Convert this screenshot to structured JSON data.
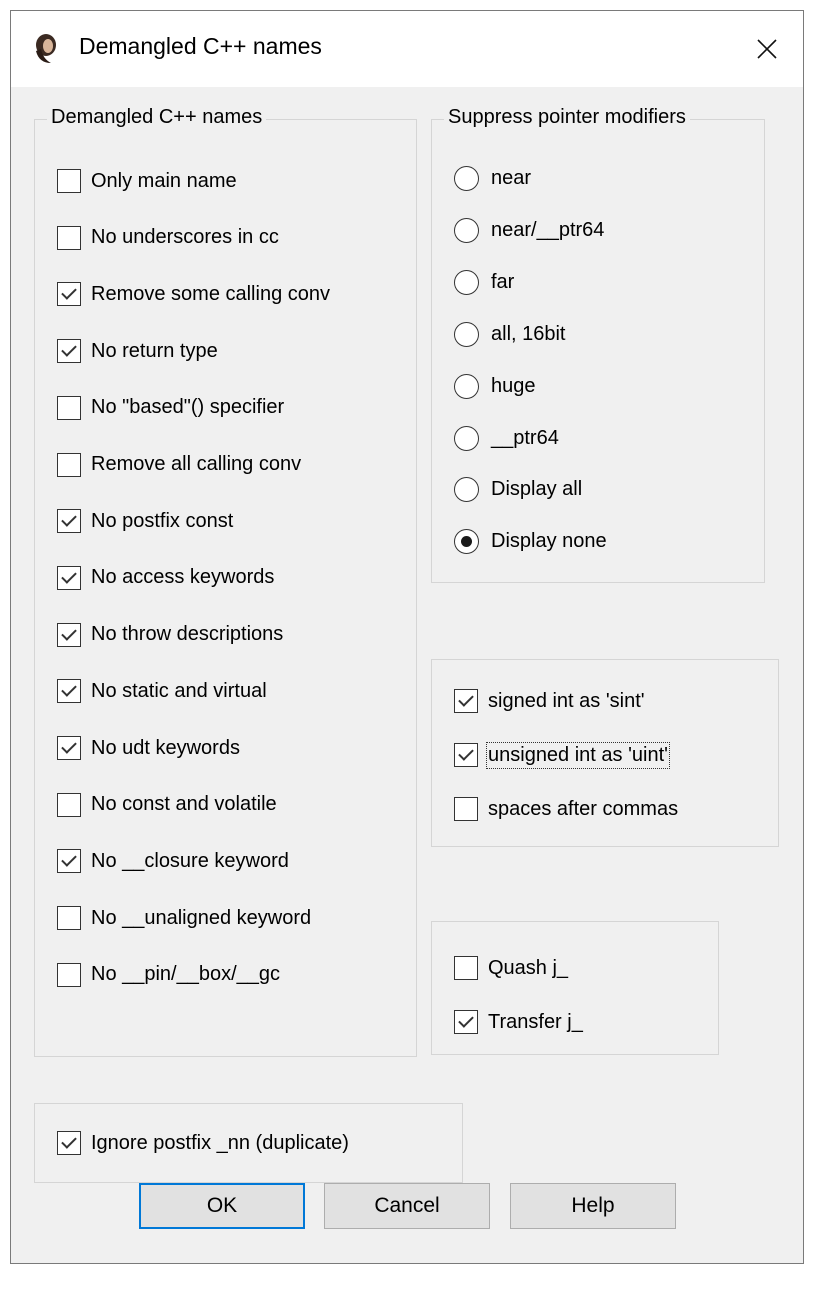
{
  "window": {
    "title": "Demangled C++ names",
    "icon": "ida-app-icon"
  },
  "left_group": {
    "label": "Demangled C++ names",
    "options": [
      {
        "label": "Only main name",
        "checked": false
      },
      {
        "label": "No underscores in cc",
        "checked": false
      },
      {
        "label": "Remove some calling conv",
        "checked": true
      },
      {
        "label": "No return type",
        "checked": true
      },
      {
        "label": "No \"based\"() specifier",
        "checked": false
      },
      {
        "label": "Remove all calling conv",
        "checked": false
      },
      {
        "label": "No postfix const",
        "checked": true
      },
      {
        "label": "No access keywords",
        "checked": true
      },
      {
        "label": "No throw descriptions",
        "checked": true
      },
      {
        "label": "No static and virtual",
        "checked": true
      },
      {
        "label": "No udt keywords",
        "checked": true
      },
      {
        "label": "No const and volatile",
        "checked": false
      },
      {
        "label": "No __closure keyword",
        "checked": true
      },
      {
        "label": "No __unaligned keyword",
        "checked": false
      },
      {
        "label": "No __pin/__box/__gc",
        "checked": false
      }
    ]
  },
  "pointer_group": {
    "label": "Suppress pointer modifiers",
    "options": [
      {
        "label": "near",
        "selected": false
      },
      {
        "label": "near/__ptr64",
        "selected": false
      },
      {
        "label": "far",
        "selected": false
      },
      {
        "label": "all, 16bit",
        "selected": false
      },
      {
        "label": "huge",
        "selected": false
      },
      {
        "label": "__ptr64",
        "selected": false
      },
      {
        "label": "Display all",
        "selected": false
      },
      {
        "label": "Display none",
        "selected": true
      }
    ]
  },
  "int_group": {
    "options": [
      {
        "label": "signed int as 'sint'",
        "checked": true
      },
      {
        "label": "unsigned int as 'uint'",
        "checked": true,
        "focused": true
      },
      {
        "label": "spaces after commas",
        "checked": false
      }
    ]
  },
  "j_group": {
    "options": [
      {
        "label": "Quash j_",
        "checked": false
      },
      {
        "label": "Transfer j_",
        "checked": true
      }
    ]
  },
  "bottom_group": {
    "options": [
      {
        "label": "Ignore postfix _nn (duplicate)",
        "checked": true
      }
    ]
  },
  "buttons": {
    "ok": "OK",
    "cancel": "Cancel",
    "help": "Help"
  }
}
